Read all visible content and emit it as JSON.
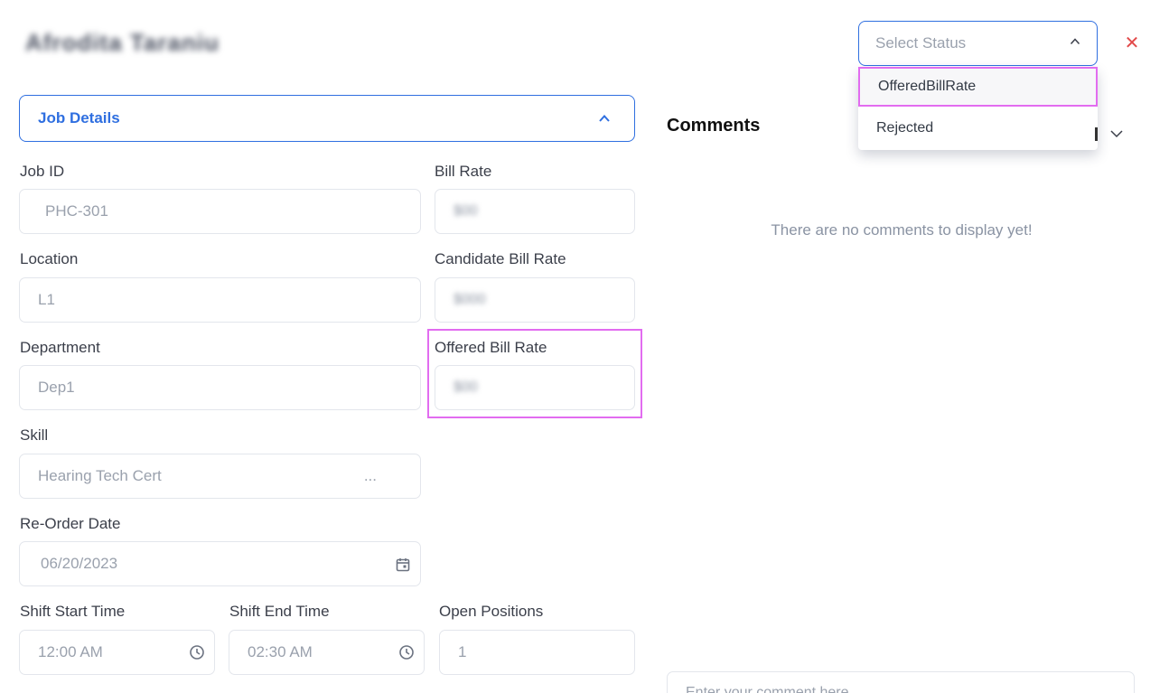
{
  "candidate": {
    "name": "Afrodita Taraniu"
  },
  "status": {
    "placeholder": "Select Status",
    "options": [
      {
        "label": "OfferedBillRate"
      },
      {
        "label": "Rejected"
      }
    ]
  },
  "job_details": {
    "title": "Job Details",
    "fields": {
      "job_id": {
        "label": "Job ID",
        "value": "PHC-301"
      },
      "bill_rate": {
        "label": "Bill Rate",
        "value": "$00"
      },
      "location": {
        "label": "Location",
        "value": "L1"
      },
      "candidate_bill_rate": {
        "label": "Candidate Bill Rate",
        "value": "$000"
      },
      "department": {
        "label": "Department",
        "value": "Dep1"
      },
      "offered_bill_rate": {
        "label": "Offered Bill Rate",
        "value": "$00"
      },
      "skill": {
        "label": "Skill",
        "value": "Hearing Tech Cert",
        "more": "..."
      },
      "reorder_date": {
        "label": "Re-Order Date",
        "value": "06/20/2023"
      },
      "shift_start": {
        "label": "Shift Start Time",
        "value": "12:00 AM"
      },
      "shift_end": {
        "label": "Shift End Time",
        "value": "02:30 AM"
      },
      "open_positions": {
        "label": "Open Positions",
        "value": "1"
      }
    }
  },
  "comments": {
    "title": "Comments",
    "empty_message": "There are no comments to display yet!",
    "input_placeholder": "Enter your comment here"
  },
  "colors": {
    "accent": "#2f6fe0",
    "highlight": "#e26cf0",
    "close": "#e24a4a"
  },
  "icons": [
    "chevron-up-icon",
    "close-icon",
    "calendar-icon",
    "clock-icon",
    "chevron-down-icon"
  ]
}
